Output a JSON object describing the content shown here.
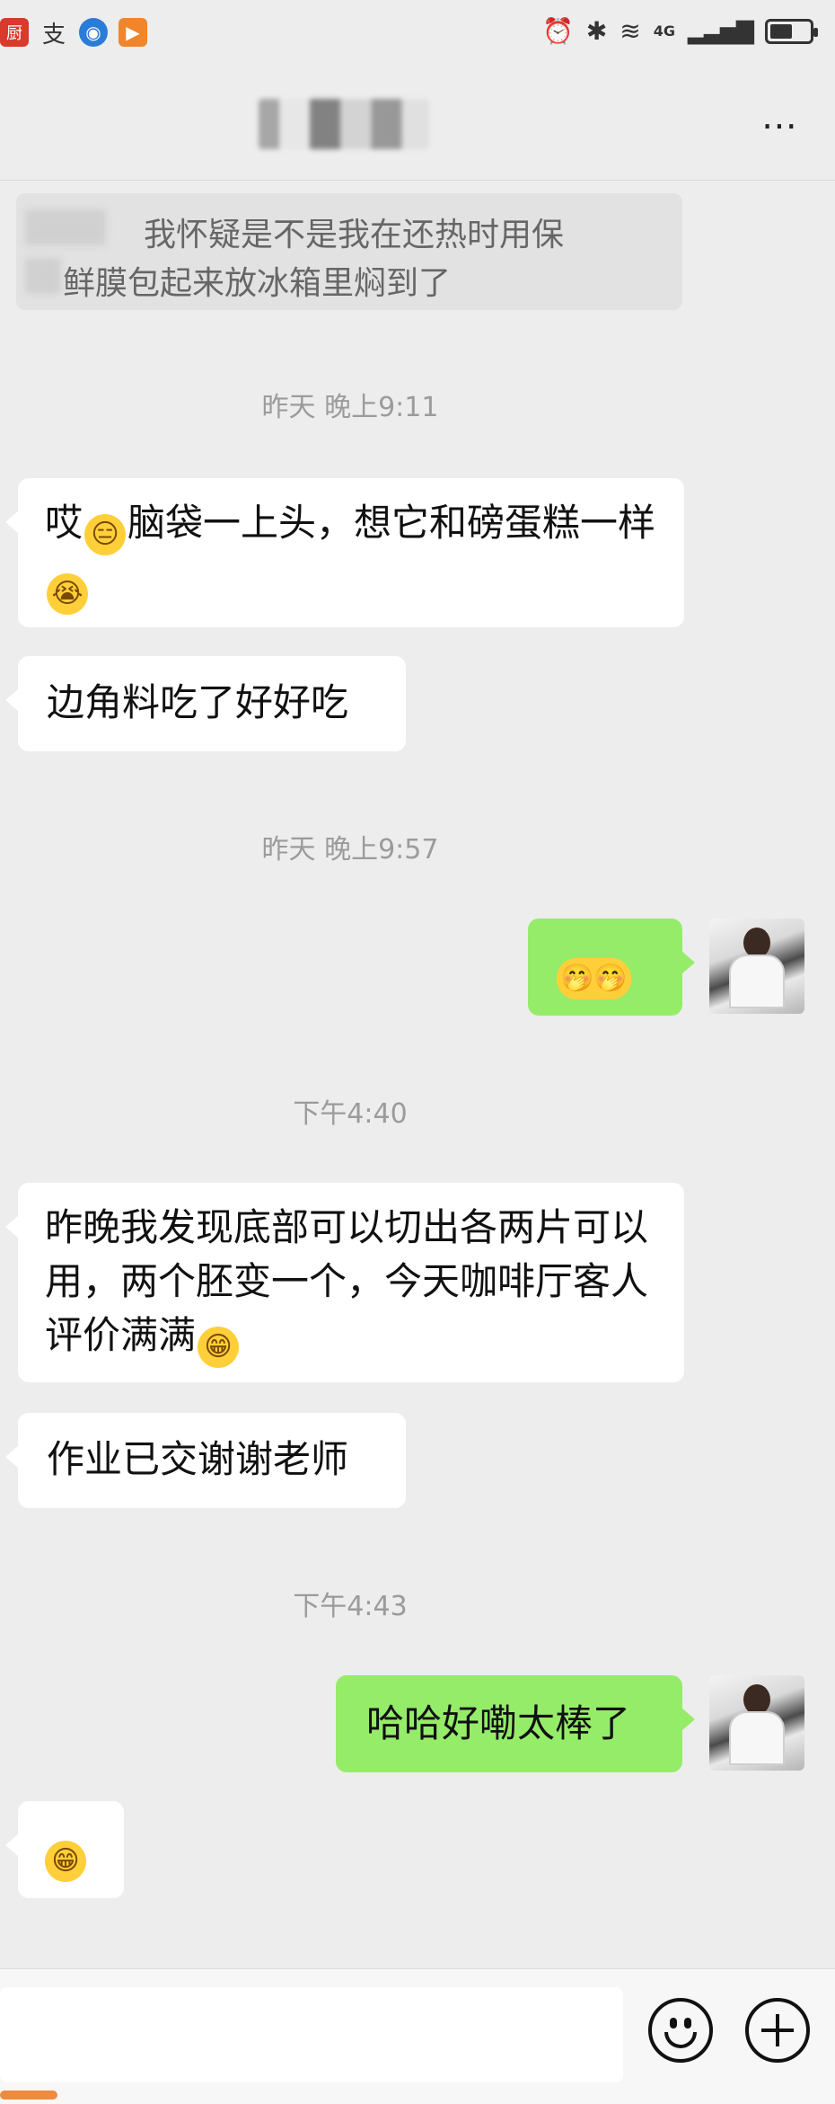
{
  "status_bar": {
    "left_icons": [
      "app-icon-1",
      "app-icon-2",
      "app-icon-3",
      "app-icon-4"
    ],
    "network": "4G",
    "battery_level": 0.5
  },
  "header": {
    "title": "",
    "more_icon": "⋯"
  },
  "quoted_message": {
    "line1": "我怀疑是不是我在还热时用保",
    "line2": "鲜膜包起来放冰箱里焖到了"
  },
  "messages": [
    {
      "type": "time",
      "text": "昨天 晚上9:11"
    },
    {
      "type": "left",
      "text": "哎",
      "emoji1": "😑",
      "text2": "脑袋一上头，想它和磅蛋糕一样",
      "emoji2": "😭"
    },
    {
      "type": "left",
      "text": "边角料吃了好好吃"
    },
    {
      "type": "time",
      "text": "昨天 晚上9:57"
    },
    {
      "type": "right",
      "emoji": "🤭🤭"
    },
    {
      "type": "time",
      "text": "下午4:40"
    },
    {
      "type": "left",
      "text": "昨晚我发现底部可以切出各两片可以用，两个胚变一个，今天咖啡厅客人评价满满",
      "emoji": "😁"
    },
    {
      "type": "left",
      "text": "作业已交谢谢老师"
    },
    {
      "type": "time",
      "text": "下午4:43"
    },
    {
      "type": "right",
      "text": "哈哈好嘞太棒了"
    },
    {
      "type": "left",
      "emoji": "😁"
    }
  ],
  "input_bar": {
    "placeholder": "",
    "emoji_button": "emoji-icon",
    "plus_button": "plus-icon"
  },
  "colors": {
    "background": "#ededed",
    "left_bubble": "#ffffff",
    "right_bubble": "#95ec69",
    "timestamp": "#9b9b9b"
  }
}
